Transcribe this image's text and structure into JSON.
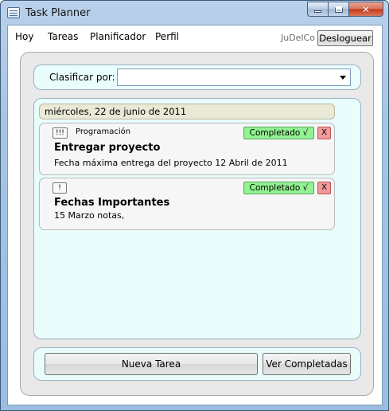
{
  "window": {
    "title": "Task Planner"
  },
  "menu": {
    "items": [
      "Hoy",
      "Tareas",
      "Planificador",
      "Perfil"
    ]
  },
  "user": {
    "name": "JuDelCo",
    "logout_label": "Desloguear"
  },
  "sort": {
    "label": "Clasificar por:",
    "value": ""
  },
  "day": {
    "date": "miércoles, 22 de junio de 2011"
  },
  "tasks": [
    {
      "priority": "!!!",
      "category": "Programación",
      "status": "Completado √",
      "delete_label": "X",
      "title": "Entregar proyecto",
      "description": "Fecha máxima entrega del proyecto 12 Abril de 2011"
    },
    {
      "priority": "!",
      "category": "",
      "status": "Completado √",
      "delete_label": "X",
      "title": "Fechas Importantes",
      "description": "15 Marzo notas,"
    }
  ],
  "actions": {
    "new_task": "Nueva Tarea",
    "show_completed": "Ver Completadas"
  },
  "colors": {
    "panel_bg": "#eafdfd",
    "status_green": "#91f291",
    "delete_red": "#f09a9a",
    "date_bg": "#eae9d6"
  }
}
